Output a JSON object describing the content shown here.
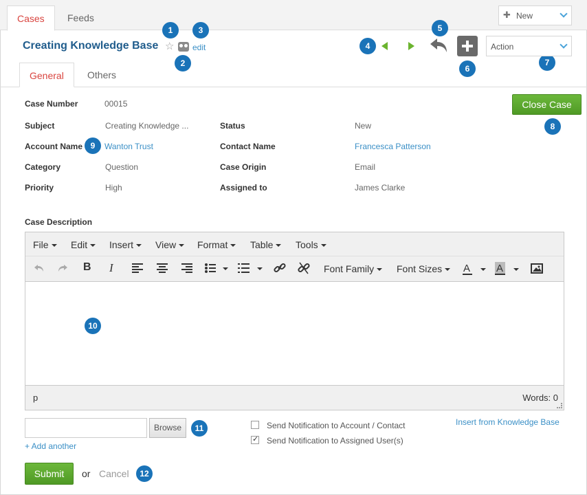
{
  "tabs": {
    "cases": "Cases",
    "feeds": "Feeds"
  },
  "new_button": {
    "label": "New"
  },
  "case_title": "Creating Knowledge Base",
  "edit_label": "edit",
  "action_select": {
    "selected": "Action"
  },
  "subtabs": {
    "general": "General",
    "others": "Others"
  },
  "close_case_label": "Close Case",
  "fields": {
    "case_number": {
      "label": "Case Number",
      "value": "00015"
    },
    "subject": {
      "label": "Subject",
      "value": "Creating Knowledge ..."
    },
    "status": {
      "label": "Status",
      "value": "New"
    },
    "account_name": {
      "label": "Account Name",
      "value": "Wanton Trust"
    },
    "contact_name": {
      "label": "Contact Name",
      "value": "Francesca Patterson"
    },
    "category": {
      "label": "Category",
      "value": "Question"
    },
    "case_origin": {
      "label": "Case Origin",
      "value": "Email"
    },
    "priority": {
      "label": "Priority",
      "value": "High"
    },
    "assigned_to": {
      "label": "Assigned to",
      "value": "James Clarke"
    }
  },
  "case_description_label": "Case Description",
  "editor": {
    "menus": [
      "File",
      "Edit",
      "Insert",
      "View",
      "Format",
      "Table",
      "Tools"
    ],
    "font_family": "Font Family",
    "font_sizes": "Font Sizes",
    "status_path": "p",
    "word_count": "Words: 0"
  },
  "browse_label": "Browse",
  "add_another": "+ Add another",
  "notify_account": "Send Notification to Account / Contact",
  "notify_account_checked": false,
  "notify_user": "Send Notification to Assigned User(s)",
  "notify_user_checked": true,
  "insert_kb": "Insert from Knowledge Base",
  "submit_label": "Submit",
  "or_text": "or",
  "cancel_label": "Cancel",
  "callouts": [
    "1",
    "2",
    "3",
    "4",
    "5",
    "6",
    "7",
    "8",
    "9",
    "10",
    "11",
    "12"
  ],
  "colors": {
    "accent_blue": "#1a73b8",
    "link": "#3a8fc6",
    "green": "#5aa52e",
    "active_tab": "#d9443f"
  }
}
